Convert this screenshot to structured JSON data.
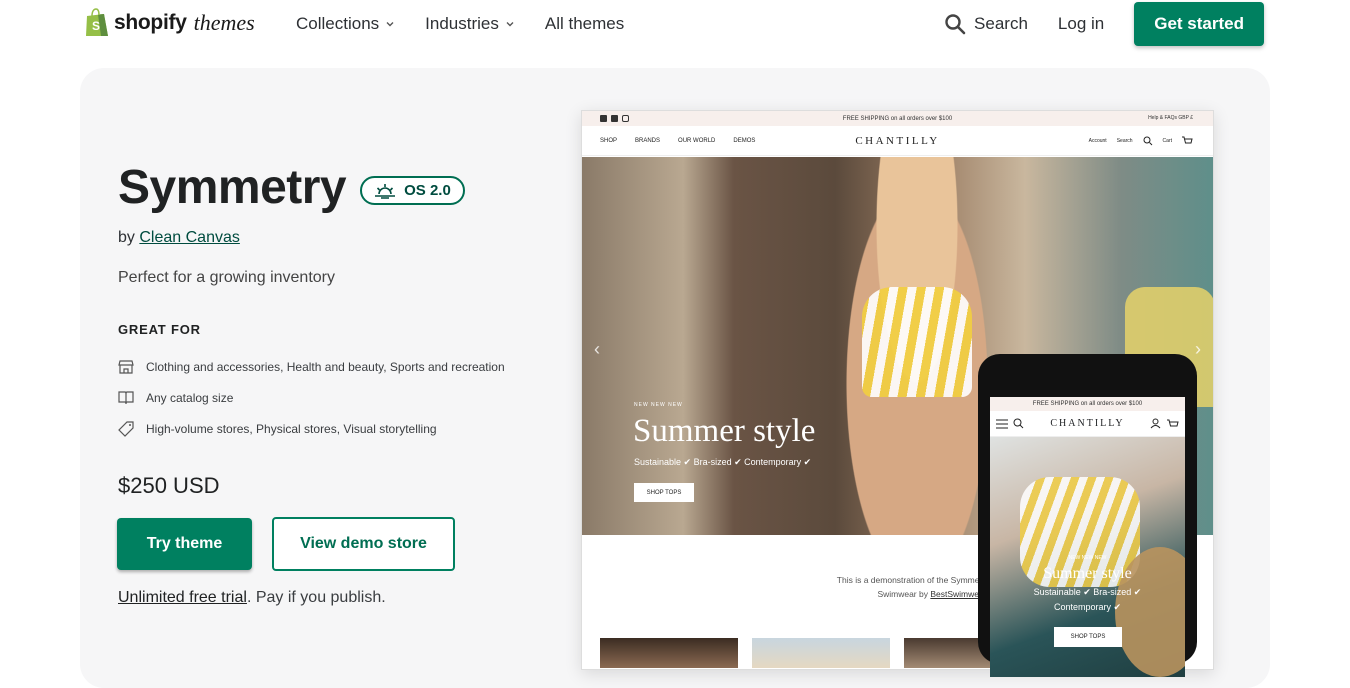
{
  "header": {
    "logo_word": "shopify",
    "logo_themes": "themes",
    "nav": [
      {
        "label": "Collections",
        "has_menu": true
      },
      {
        "label": "Industries",
        "has_menu": true
      },
      {
        "label": "All themes",
        "has_menu": false
      }
    ],
    "search_label": "Search",
    "login_label": "Log in",
    "cta_label": "Get started"
  },
  "theme": {
    "name": "Symmetry",
    "badge": "OS 2.0",
    "by_prefix": "by",
    "author": "Clean Canvas",
    "tagline": "Perfect for a growing inventory",
    "great_for_heading": "GREAT FOR",
    "features": [
      {
        "icon": "store-icon",
        "text": "Clothing and accessories, Health and beauty, Sports and recreation"
      },
      {
        "icon": "book-icon",
        "text": "Any catalog size"
      },
      {
        "icon": "tag-icon",
        "text": "High-volume stores, Physical stores, Visual storytelling"
      }
    ],
    "price": "$250 USD",
    "try_label": "Try theme",
    "demo_label": "View demo store",
    "trial_link": "Unlimited free trial",
    "trial_rest": ". Pay if you publish."
  },
  "preview": {
    "promo": "FREE SHIPPING on all orders over $100",
    "help": "Help & FAQs   GBP £",
    "links": [
      "SHOP",
      "BRANDS",
      "OUR WORLD",
      "DEMOS"
    ],
    "brand": "CHANTILLY",
    "account": "Account",
    "search": "Search",
    "cart": "Cart",
    "kicker": "NEW NEW NEW",
    "headline": "Summer style",
    "sub": "Sustainable ✔ Bra-sized ✔ Contemporary ✔",
    "cta": "SHOP TOPS",
    "note_line1": "This is a demonstration of the Symmetry theme for",
    "note_line2_prefix": "Swimwear by ",
    "note_link": "BestSwimwear"
  },
  "phone": {
    "promo": "FREE SHIPPING on all orders over $100",
    "brand": "CHANTILLY",
    "kicker": "NEW NEW NEW",
    "headline": "Summer style",
    "sub1": "Sustainable ✔ Bra-sized ✔",
    "sub2": "Contemporary ✔",
    "cta": "SHOP TOPS"
  },
  "colors": {
    "accent": "#008060",
    "panel": "#f6f6f7"
  }
}
